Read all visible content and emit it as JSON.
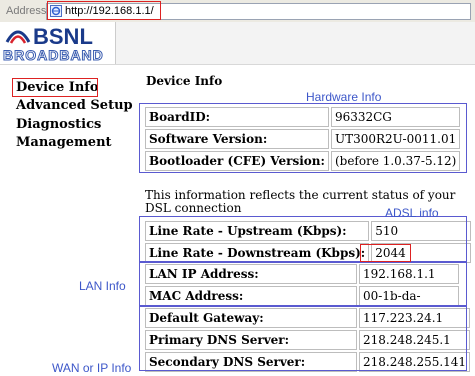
{
  "browser": {
    "address_label": "Address",
    "url": "http://192.168.1.1/"
  },
  "brand": {
    "name": "BSNL",
    "tagline": "BROADBAND"
  },
  "sidebar": {
    "items": [
      {
        "label": "Device Info"
      },
      {
        "label": "Advanced Setup"
      },
      {
        "label": "Diagnostics"
      },
      {
        "label": "Management"
      }
    ]
  },
  "main": {
    "title": "Device Info",
    "hardware": [
      {
        "label": "BoardID:",
        "value": "96332CG"
      },
      {
        "label": "Software Version:",
        "value": "UT300R2U-0011.01"
      },
      {
        "label": "Bootloader (CFE) Version:",
        "value": "(before 1.0.37-5.12)"
      }
    ],
    "status_text": "This information reflects the current status of your DSL connection",
    "adsl": [
      {
        "label": "Line Rate - Upstream (Kbps):",
        "value": "510"
      },
      {
        "label": "Line Rate - Downstream (Kbps):",
        "value": "2044"
      }
    ],
    "lan": [
      {
        "label": "LAN IP Address:",
        "value": "192.168.1.1"
      },
      {
        "label": "MAC Address:",
        "value": "00-1b-da-"
      }
    ],
    "wan": [
      {
        "label": "Default Gateway:",
        "value": "117.223.24.1"
      },
      {
        "label": "Primary DNS Server:",
        "value": "218.248.245.1"
      },
      {
        "label": "Secondary DNS Server:",
        "value": "218.248.255.141"
      }
    ]
  },
  "annotations": {
    "hardware": "Hardware Info",
    "adsl": "ADSL info",
    "lan": "LAN Info",
    "wan": "WAN or IP Info"
  },
  "colors": {
    "annotation": "#3d57c9",
    "highlight": "#dd2222",
    "brand": "#1a3a8a"
  },
  "icons": {
    "address": "ie-page-icon",
    "logo": "bsnl-logo-icon"
  }
}
